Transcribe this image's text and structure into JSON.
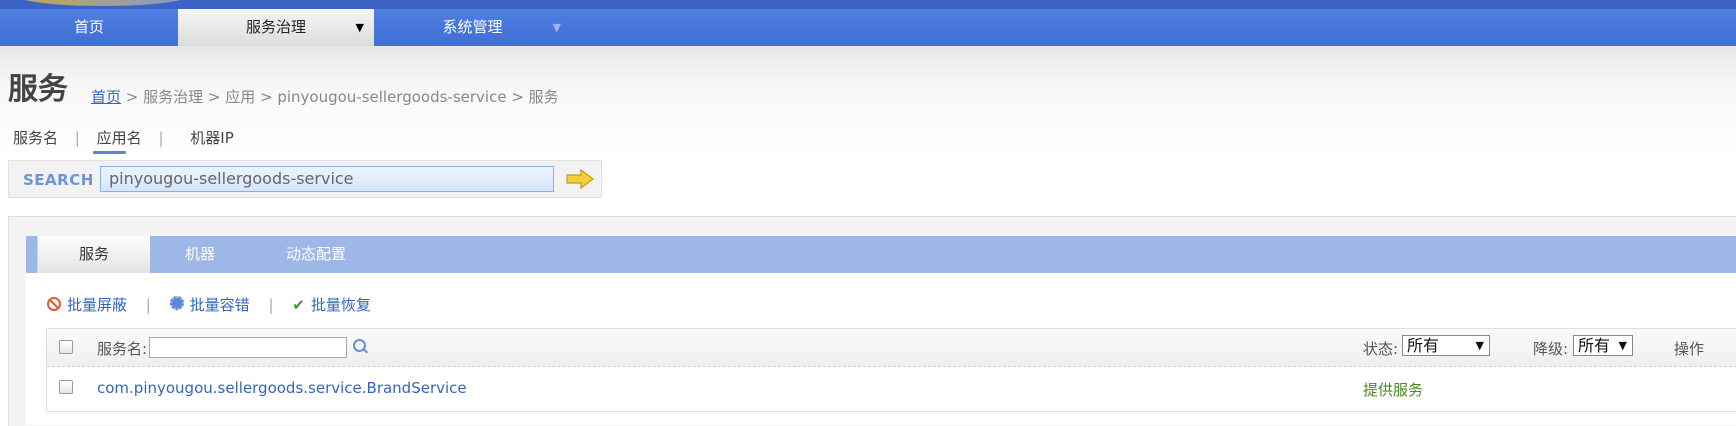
{
  "nav": {
    "items": [
      {
        "label": "首页"
      },
      {
        "label": "服务治理"
      },
      {
        "label": "系统管理"
      }
    ]
  },
  "page": {
    "title": "服务",
    "breadcrumb": {
      "home": "首页",
      "rest": " > 服务治理 > 应用 > pinyougou-sellergoods-service > 服务"
    }
  },
  "filters": {
    "items": [
      "服务名",
      "应用名",
      "机器IP"
    ],
    "separator": "|",
    "active": "应用名"
  },
  "search": {
    "label": "SEARCH",
    "value": "pinyougou-sellergoods-service"
  },
  "tabs": [
    {
      "label": "服务"
    },
    {
      "label": "机器"
    },
    {
      "label": "动态配置"
    }
  ],
  "actions": {
    "batch_block": "批量屏蔽",
    "batch_fault_tolerance": "批量容错",
    "batch_restore": "批量恢复",
    "separator": "|"
  },
  "table": {
    "header": {
      "service_name_label": "服务名:",
      "status_label": "状态:",
      "status_value": "所有",
      "degrade_label": "降级:",
      "degrade_value": "所有",
      "operation_label": "操作"
    },
    "rows": [
      {
        "service": "com.pinyougou.sellergoods.service.BrandService",
        "status": "提供服务"
      }
    ]
  },
  "colors": {
    "nav_blue": "#3f6ed6",
    "tab_blue": "#9db8e6",
    "link_blue": "#3366bb",
    "status_green": "#4c8a20"
  }
}
